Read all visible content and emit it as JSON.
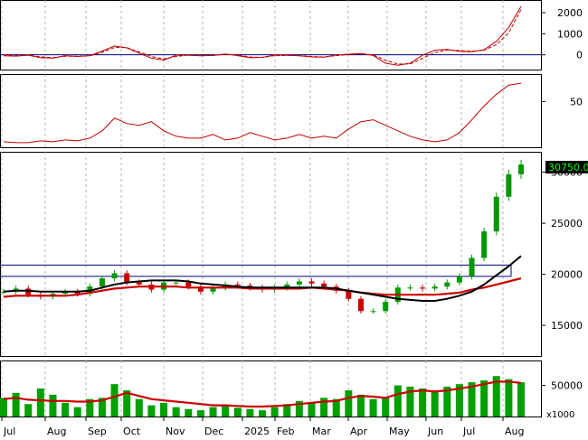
{
  "chart_data": [
    {
      "type": "line",
      "panel": "macd",
      "y_ticks": [
        2000,
        1000,
        0
      ],
      "ylim": [
        -700,
        2600
      ],
      "series": [
        {
          "values": [
            -50,
            -60,
            -20,
            -140,
            -150,
            -40,
            -80,
            -40,
            180,
            420,
            330,
            80,
            -160,
            -250,
            -20,
            -20,
            -50,
            -30,
            40,
            -40,
            -140,
            -120,
            -10,
            -20,
            -50,
            -100,
            -110,
            -10,
            30,
            60,
            -30,
            -400,
            -500,
            -400,
            -20,
            220,
            260,
            160,
            150,
            240,
            640,
            1300,
            2300
          ]
        },
        {
          "values": [
            0,
            -40,
            -10,
            -100,
            -130,
            -70,
            -60,
            -50,
            120,
            350,
            340,
            130,
            -80,
            -200,
            -80,
            -20,
            -40,
            -30,
            20,
            -10,
            -100,
            -120,
            -40,
            -30,
            -40,
            -80,
            -100,
            -40,
            10,
            50,
            0,
            -260,
            -440,
            -430,
            -170,
            110,
            230,
            200,
            170,
            220,
            480,
            1050,
            2150
          ]
        }
      ],
      "zero_line": true
    },
    {
      "type": "line",
      "panel": "rsi",
      "y_ticks": [
        50
      ],
      "ylim": [
        0,
        80
      ],
      "series": [
        {
          "values": [
            6,
            5,
            5,
            7,
            6,
            8,
            7,
            10,
            18,
            32,
            26,
            24,
            28,
            18,
            12,
            10,
            10,
            14,
            8,
            10,
            16,
            12,
            8,
            10,
            14,
            10,
            12,
            10,
            20,
            28,
            30,
            24,
            18,
            12,
            8,
            6,
            8,
            16,
            30,
            45,
            58,
            68,
            70
          ]
        }
      ]
    },
    {
      "type": "candlestick",
      "panel": "price",
      "y_ticks": [
        30000,
        25000,
        20000,
        15000
      ],
      "ylim": [
        12000,
        32000
      ],
      "last_price": "30750.00",
      "x_labels": [
        "Jul",
        "Aug",
        "Sep",
        "Oct",
        "Nov",
        "Dec",
        "2025",
        "Feb",
        "Mar",
        "Apr",
        "May",
        "Jun",
        "Jul",
        "Aug"
      ],
      "close": [
        18300,
        18600,
        18000,
        17800,
        18100,
        18300,
        18100,
        18800,
        19600,
        20100,
        19200,
        19000,
        18500,
        19200,
        19200,
        18800,
        18300,
        18700,
        19000,
        18900,
        18700,
        18500,
        18700,
        19000,
        19300,
        19100,
        18800,
        18400,
        17600,
        16400,
        16400,
        17300,
        18700,
        18700,
        18600,
        18800,
        19200,
        19800,
        21600,
        24200,
        27600,
        29800,
        30750
      ],
      "ma_black": [
        18300,
        18400,
        18400,
        18300,
        18300,
        18300,
        18300,
        18400,
        18700,
        19000,
        19200,
        19300,
        19400,
        19400,
        19400,
        19300,
        19100,
        19000,
        18900,
        18800,
        18700,
        18700,
        18700,
        18700,
        18700,
        18700,
        18700,
        18600,
        18400,
        18200,
        18000,
        17800,
        17600,
        17500,
        17400,
        17400,
        17600,
        17900,
        18300,
        19000,
        19900,
        20800,
        21800
      ],
      "ma_red": [
        17800,
        17900,
        17900,
        17900,
        17900,
        17900,
        18000,
        18200,
        18400,
        18600,
        18700,
        18800,
        18800,
        18800,
        18800,
        18700,
        18700,
        18700,
        18700,
        18700,
        18600,
        18600,
        18600,
        18600,
        18600,
        18700,
        18600,
        18500,
        18400,
        18200,
        18100,
        18000,
        18000,
        18000,
        18000,
        18000,
        18100,
        18200,
        18500,
        18700,
        19000,
        19300,
        19600
      ],
      "resistance_band": [
        19800,
        20900
      ]
    },
    {
      "type": "bar",
      "panel": "volume",
      "y_ticks": [
        50000
      ],
      "unit_label": "x1000",
      "ylim": [
        0,
        90000
      ],
      "values": [
        30000,
        38000,
        20000,
        45000,
        35000,
        22000,
        15000,
        28000,
        30000,
        52000,
        42000,
        28000,
        18000,
        22000,
        15000,
        12000,
        10000,
        15000,
        18000,
        14000,
        12000,
        10000,
        15000,
        20000,
        25000,
        22000,
        30000,
        28000,
        42000,
        35000,
        28000,
        30000,
        50000,
        48000,
        45000,
        42000,
        48000,
        52000,
        55000,
        58000,
        65000,
        60000,
        55000
      ],
      "ma": [
        28000,
        30000,
        27000,
        26000,
        25000,
        25000,
        24000,
        24000,
        26000,
        32000,
        38000,
        33000,
        28000,
        26000,
        24000,
        22000,
        20000,
        18000,
        18000,
        17000,
        16000,
        16000,
        17000,
        18000,
        20000,
        22000,
        24000,
        25000,
        30000,
        33000,
        32000,
        30000,
        36000,
        40000,
        42000,
        40000,
        42000,
        45000,
        48000,
        52000,
        56000,
        56000,
        54000
      ]
    }
  ]
}
